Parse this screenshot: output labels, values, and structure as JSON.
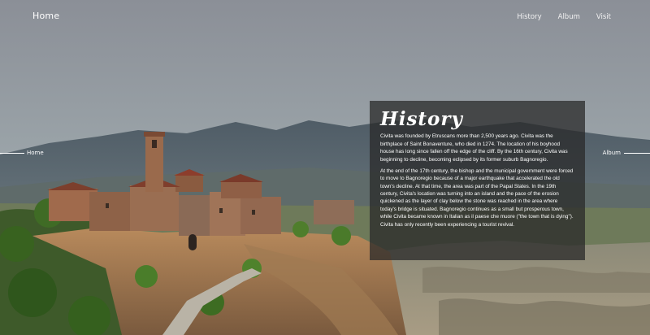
{
  "nav": {
    "home_label": "Home",
    "links": [
      {
        "label": "History"
      },
      {
        "label": "Album"
      },
      {
        "label": "Visit"
      }
    ]
  },
  "side": {
    "left_label": "Home",
    "right_label": "Album"
  },
  "panel": {
    "title": "History",
    "paragraphs": [
      "Civita was founded by Etruscans more than 2,500 years ago. Civita was the birthplace of Saint Bonaventure, who died in 1274. The location of his boyhood house has long since fallen off the edge of the cliff. By the 16th century, Civita was beginning to decline, becoming eclipsed by its former suburb Bagnoregio.",
      "At the end of the 17th century, the bishop and the municipal government were forced to move to Bagnoregio because of a major earthquake that accelerated the old town's decline. At that time, the area was part of the Papal States. In the 19th century, Civita's location was turning into an island and the pace of the erosion quickened as the layer of clay below the stone was reached in the area where today's bridge is situated. Bagnoregio continues as a small but prosperous town, while Civita became known in Italian as il paese che muore (\"the town that is dying\"). Civita has only recently been experiencing a tourist revival."
    ]
  },
  "colors": {
    "panel_bg": "#282828",
    "text": "#ffffff"
  }
}
